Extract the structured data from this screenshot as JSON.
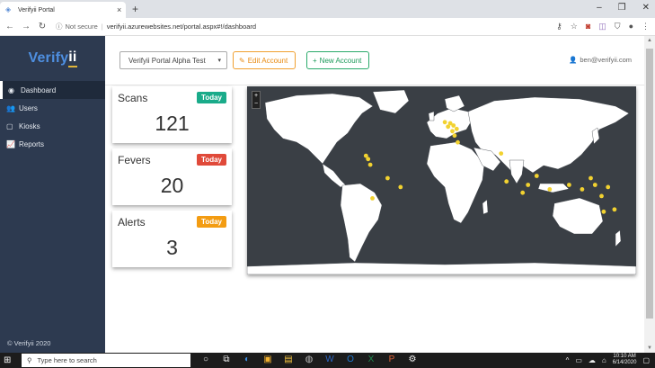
{
  "browser": {
    "tab_title": "Verifyii Portal",
    "tab_close": "×",
    "new_tab": "+",
    "security": "Not secure",
    "url": "verifyii.azurewebsites.net/portal.aspx#!/dashboard",
    "window_controls": [
      "–",
      "❐",
      "✕"
    ]
  },
  "sidebar": {
    "brand_main": "Verify",
    "brand_accent": "ii",
    "items": [
      {
        "label": "Dashboard",
        "icon": "dashboard-icon",
        "glyph": "◉"
      },
      {
        "label": "Users",
        "icon": "users-icon",
        "glyph": "👥"
      },
      {
        "label": "Kiosks",
        "icon": "kiosk-icon",
        "glyph": "▢"
      },
      {
        "label": "Reports",
        "icon": "chart-icon",
        "glyph": "📈"
      }
    ],
    "footer": "© Verifyii 2020"
  },
  "topbar": {
    "org_select": "Verifyii Portal Alpha Test",
    "edit_button": "Edit Account",
    "new_button": "New Account",
    "user_email": "ben@verifyii.com"
  },
  "cards": [
    {
      "label": "Scans",
      "badge": "Today",
      "value": "121",
      "badge_color": "#1aab8a"
    },
    {
      "label": "Fevers",
      "badge": "Today",
      "value": "20",
      "badge_color": "#e04a3a"
    },
    {
      "label": "Alerts",
      "badge": "Today",
      "value": "3",
      "badge_color": "#f39c12"
    }
  ],
  "map": {
    "zoom_in": "+",
    "zoom_out": "−",
    "marker_color": "#f2d230",
    "markers": [
      {
        "lon": 3,
        "lat": 48
      },
      {
        "lon": 8,
        "lat": 47
      },
      {
        "lon": 11,
        "lat": 45
      },
      {
        "lon": 14,
        "lat": 42
      },
      {
        "lon": 6,
        "lat": 44
      },
      {
        "lon": 10,
        "lat": 40
      },
      {
        "lon": 12,
        "lat": 36
      },
      {
        "lon": 15,
        "lat": 30
      },
      {
        "lon": -70,
        "lat": 18
      },
      {
        "lon": -68,
        "lat": 15
      },
      {
        "lon": -66,
        "lat": 10
      },
      {
        "lon": -50,
        "lat": -2
      },
      {
        "lon": -38,
        "lat": -10
      },
      {
        "lon": -64,
        "lat": -20
      },
      {
        "lon": 55,
        "lat": 20
      },
      {
        "lon": 60,
        "lat": -5
      },
      {
        "lon": 75,
        "lat": -15
      },
      {
        "lon": 80,
        "lat": -8
      },
      {
        "lon": 88,
        "lat": 0
      },
      {
        "lon": 100,
        "lat": -12
      },
      {
        "lon": 118,
        "lat": -8
      },
      {
        "lon": 130,
        "lat": -12
      },
      {
        "lon": 138,
        "lat": -2
      },
      {
        "lon": 142,
        "lat": -8
      },
      {
        "lon": 148,
        "lat": -18
      },
      {
        "lon": 154,
        "lat": -10
      },
      {
        "lon": 160,
        "lat": -30
      },
      {
        "lon": 150,
        "lat": -32
      }
    ]
  },
  "taskbar": {
    "search_placeholder": "Type here to search",
    "time": "10:10 AM",
    "date": "6/14/2020"
  }
}
